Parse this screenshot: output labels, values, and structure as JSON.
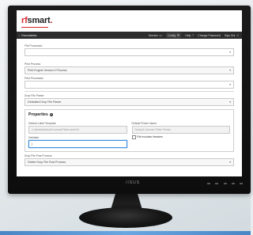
{
  "brand": {
    "name": "/ISUS"
  },
  "app": {
    "logo_prefix": "rf",
    "logo_main": "smart",
    "logo_suffix": "."
  },
  "topbar": {
    "back_label": "Executables",
    "items": [
      {
        "label": "Monitor",
        "icon": "monitor-icon"
      },
      {
        "label": "Config",
        "icon": "gear-icon"
      },
      {
        "label": "Help",
        "icon": "help-icon"
      },
      {
        "label": "Change Password",
        "icon": ""
      },
      {
        "label": "Sign Out",
        "icon": "user-icon"
      }
    ]
  },
  "form": {
    "file_processed_label": "File Processed",
    "file_processed_value": "",
    "print_process_label": "Print Process",
    "print_process_value": "Print Engine Version 4 Process",
    "print_processes_label": "Print Processes",
    "print_processes_value": "",
    "drop_file_parser_label": "Drop File Parser",
    "drop_file_parser_value": "Defaulted Drop File Parser",
    "properties_title": "Properties",
    "default_label_template_label": "Default Label Template",
    "default_label_template_value": "c:\\labels\\default\\LicensePlateLabel.lbl",
    "default_printer_label": "Default Printer Name",
    "default_printer_value": "Default License Plate Printer",
    "delimiter_label": "Delimiter",
    "delimiter_value": "|",
    "file_headers_label": "File Includes Headers",
    "drop_file_post_process_label": "Drop File Post Process",
    "drop_file_post_process_value": "Delete Drop File Post Process"
  }
}
